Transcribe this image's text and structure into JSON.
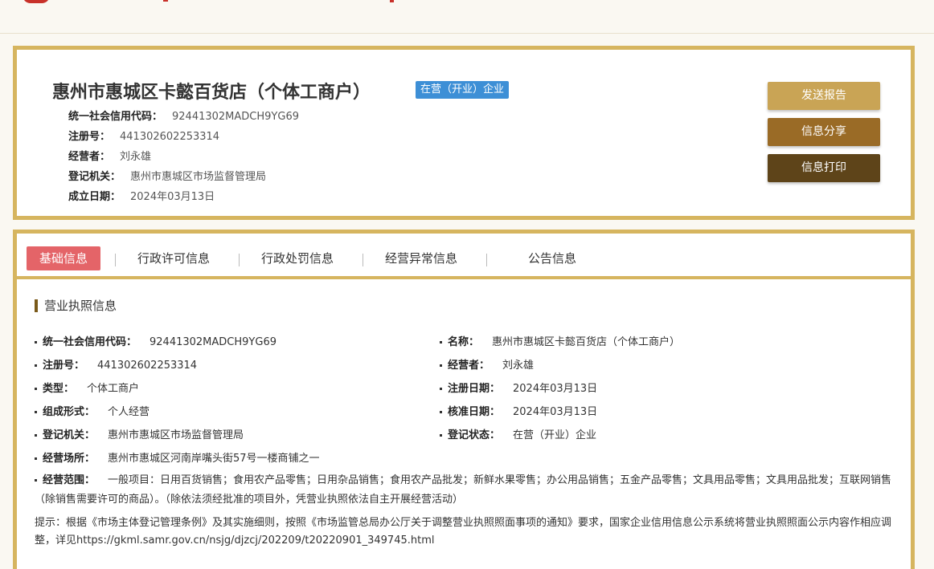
{
  "company": {
    "name": "惠州市惠城区卡懿百货店（个体工商户）",
    "status_badge": "在营（开业）企业",
    "summary": [
      {
        "label": "统一社会信用代码：",
        "value": "92441302MADCH9YG69"
      },
      {
        "label": "注册号：",
        "value": "441302602253314"
      },
      {
        "label": "经营者：",
        "value": "刘永雄"
      },
      {
        "label": "登记机关：",
        "value": "惠州市惠城区市场监督管理局"
      },
      {
        "label": "成立日期：",
        "value": "2024年03月13日"
      }
    ]
  },
  "actions": {
    "send_report": "发送报告",
    "share": "信息分享",
    "print": "信息打印"
  },
  "tabs": [
    {
      "label": "基础信息",
      "active": true
    },
    {
      "label": "行政许可信息",
      "active": false
    },
    {
      "label": "行政处罚信息",
      "active": false
    },
    {
      "label": "经营异常信息",
      "active": false
    },
    {
      "label": "公告信息",
      "active": false
    }
  ],
  "license": {
    "section_title": "营业执照信息",
    "left": [
      {
        "label": "统一社会信用代码：",
        "value": "92441302MADCH9YG69"
      },
      {
        "label": "注册号：",
        "value": "441302602253314"
      },
      {
        "label": "类型：",
        "value": "个体工商户"
      },
      {
        "label": "组成形式：",
        "value": "个人经营"
      },
      {
        "label": "登记机关：",
        "value": "惠州市惠城区市场监督管理局"
      },
      {
        "label": "经营场所：",
        "value": "惠州市惠城区河南岸嘴头街57号一楼商铺之一"
      }
    ],
    "right": [
      {
        "label": "名称：",
        "value": "惠州市惠城区卡懿百货店（个体工商户）"
      },
      {
        "label": "经营者：",
        "value": "刘永雄"
      },
      {
        "label": "注册日期：",
        "value": "2024年03月13日"
      },
      {
        "label": "核准日期：",
        "value": "2024年03月13日"
      },
      {
        "label": "登记状态：",
        "value": "在营（开业）企业"
      }
    ],
    "scope_label": "经营范围：",
    "scope_value": "一般项目：日用百货销售；食用农产品零售；日用杂品销售；食用农产品批发；新鲜水果零售；办公用品销售；五金产品零售；文具用品零售；文具用品批发；互联网销售（除销售需要许可的商品）。（除依法须经批准的项目外，凭营业执照依法自主开展经营活动）",
    "tip": "提示：根据《市场主体登记管理条例》及其实施细则，按照《市场监管总局办公厅关于调整营业执照照面事项的通知》要求，国家企业信用信息公示系统将营业执照照面公示内容作相应调整，详见https://gkml.samr.gov.cn/nsjg/djzcj/202209/t20220901_349745.html"
  },
  "colors": {
    "border_gold": "#d6b55f",
    "badge_blue": "#3d8fd6",
    "tab_active": "#e46468",
    "btn_send": "#c9a455",
    "btn_share": "#9a6b26",
    "btn_print": "#5e4419"
  }
}
